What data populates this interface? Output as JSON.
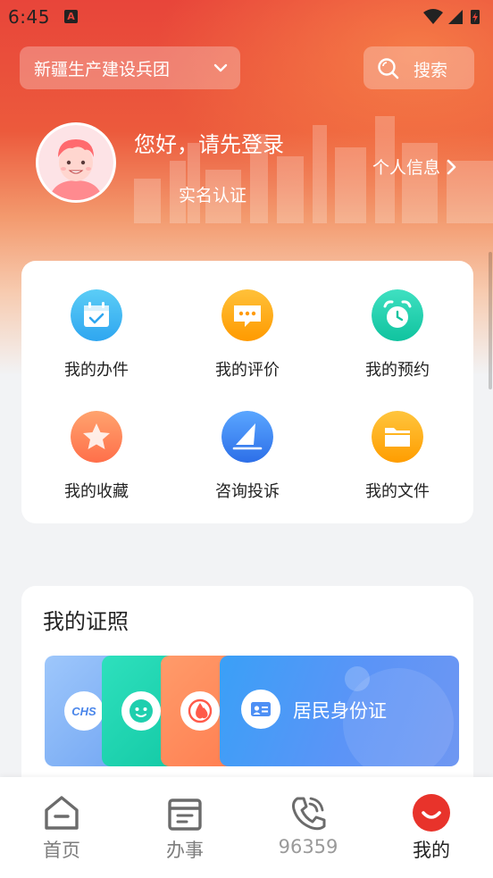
{
  "status_bar": {
    "time": "6:45",
    "notification_icon": "A"
  },
  "header": {
    "region": "新疆生产建设兵团",
    "search_label": "搜索",
    "greeting": "您好，请先登录",
    "realname_label": "实名认证",
    "personal_info_label": "个人信息"
  },
  "functions": [
    {
      "label": "我的办件",
      "icon": "calendar-check-icon",
      "color_start": "#5bcdf6",
      "color_end": "#2fa6f0"
    },
    {
      "label": "我的评价",
      "icon": "chat-bubble-icon",
      "color_start": "#ffc13a",
      "color_end": "#ff9a00"
    },
    {
      "label": "我的预约",
      "icon": "alarm-clock-icon",
      "color_start": "#3fe0c1",
      "color_end": "#10c39f"
    },
    {
      "label": "我的收藏",
      "icon": "star-icon",
      "color_start": "#ffa36e",
      "color_end": "#ff6f4a"
    },
    {
      "label": "咨询投诉",
      "icon": "paper-plane-icon",
      "color_start": "#5aa6ff",
      "color_end": "#2d6fe8"
    },
    {
      "label": "我的文件",
      "icon": "folder-icon",
      "color_start": "#ffc53d",
      "color_end": "#ff9d00"
    }
  ],
  "licenses": {
    "title": "我的证照",
    "items": [
      {
        "label": "CHS",
        "color": "#7fb3f5"
      },
      {
        "label": "",
        "color": "#1fd3b0"
      },
      {
        "label": "",
        "color": "#ff8a5c"
      },
      {
        "label": "居民身份证",
        "color": "#4f96f7"
      }
    ]
  },
  "bottom_nav": [
    {
      "label": "首页",
      "active": false
    },
    {
      "label": "办事",
      "active": false
    },
    {
      "label": "96359",
      "active": false
    },
    {
      "label": "我的",
      "active": true
    }
  ],
  "colors": {
    "brand_red": "#e8453a",
    "active_tab": "#e8332b"
  }
}
